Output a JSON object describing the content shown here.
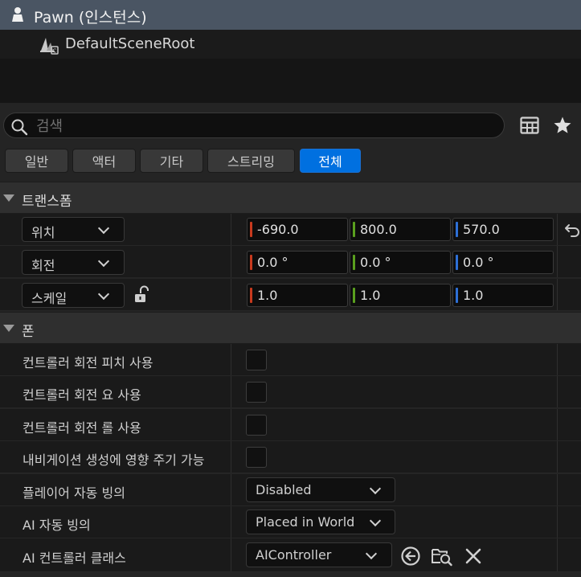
{
  "tree": {
    "root_label": "Pawn (인스턴스)",
    "child_label": "DefaultSceneRoot"
  },
  "search": {
    "placeholder": "검색"
  },
  "tabs": [
    {
      "label": "일반",
      "active": false
    },
    {
      "label": "액터",
      "active": false
    },
    {
      "label": "기타",
      "active": false
    },
    {
      "label": "스트리밍",
      "active": false
    },
    {
      "label": "전체",
      "active": true
    }
  ],
  "transform": {
    "category": "트랜스폼",
    "location": {
      "mode": "위치",
      "x": "-690.0",
      "y": "800.0",
      "z": "570.0"
    },
    "rotation": {
      "mode": "회전",
      "x": "0.0 °",
      "y": "0.0 °",
      "z": "0.0 °"
    },
    "scale": {
      "mode": "스케일",
      "x": "1.0",
      "y": "1.0",
      "z": "1.0"
    }
  },
  "pawn": {
    "category": "폰",
    "use_pitch": "컨트롤러 회전 피치 사용",
    "use_yaw": "컨트롤러 회전 요 사용",
    "use_roll": "컨트롤러 회전 롤 사용",
    "nav_affect": "내비게이션 생성에 영향 주기 가능",
    "auto_possess_player": {
      "label": "플레이어 자동 빙의",
      "value": "Disabled"
    },
    "auto_possess_ai": {
      "label": "AI 자동 빙의",
      "value": "Placed in World"
    },
    "ai_controller_class": {
      "label": "AI 컨트롤러 클래스",
      "value": "AIController"
    }
  },
  "colors": {
    "accent": "#0070e0",
    "axis_x": "#c83a1e",
    "axis_y": "#5aa01e",
    "axis_z": "#2d6fd6",
    "selected_row": "#4a5563"
  }
}
